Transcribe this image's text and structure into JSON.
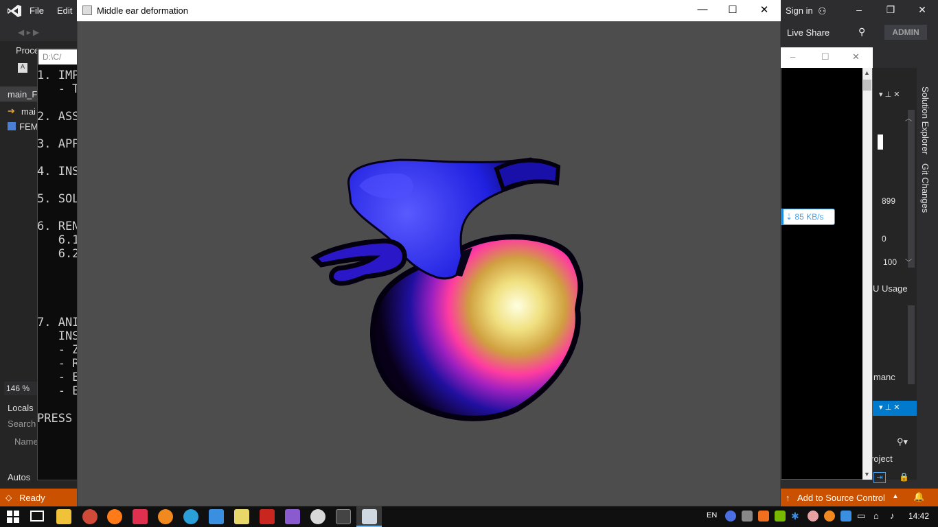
{
  "vs": {
    "menu": [
      "File",
      "Edit"
    ],
    "sign_in": "Sign in",
    "live_share": "Live Share",
    "admin": "ADMIN",
    "left_labels": [
      "Proce",
      "main_FE",
      "mai",
      "FEM",
      "146 %",
      "Locals",
      "Search",
      "Name",
      "Autos"
    ],
    "right_values": [
      "899",
      "0",
      "100"
    ],
    "right_labels": [
      "U Usage",
      "manc",
      "roject"
    ],
    "side_tabs": [
      "Solution Explorer",
      "Git Changes"
    ],
    "status_ready": "Ready",
    "add_source": "Add to Source Control"
  },
  "console": {
    "title": "D:\\C/",
    "lines": [
      "1. IMP",
      "   - T",
      "2. ASS",
      "3. APP",
      "4. INS",
      "5. SOL",
      "6. REN",
      "   6.1",
      "   6.2",
      "7. ANI",
      "   INS",
      "   - Z",
      "   - R",
      "   - E",
      "   - E",
      "PRESS"
    ]
  },
  "download": {
    "speed": "85 KB/s"
  },
  "main_window": {
    "title": "Middle ear deformation",
    "minimize": "—",
    "maximize": "☐",
    "close": "✕",
    "bg_color": "#4d4d4d"
  },
  "taskbar": {
    "lang": "EN",
    "time": "14:42"
  }
}
